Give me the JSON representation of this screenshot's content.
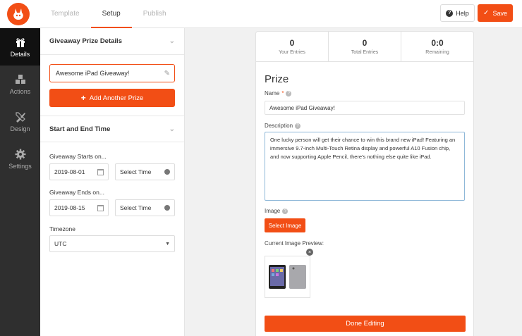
{
  "header": {
    "tabs": [
      {
        "label": "Template"
      },
      {
        "label": "Setup"
      },
      {
        "label": "Publish"
      }
    ],
    "help_label": "Help",
    "save_label": "Save",
    "accent_color": "#f24e15"
  },
  "sidebar": {
    "items": [
      {
        "label": "Details",
        "icon": "gift-icon",
        "active": true
      },
      {
        "label": "Actions",
        "icon": "cubes-icon"
      },
      {
        "label": "Design",
        "icon": "paint-brush-icon"
      },
      {
        "label": "Settings",
        "icon": "gear-icon"
      }
    ]
  },
  "panel": {
    "prize_section_title": "Giveaway Prize Details",
    "prize_name": "Awesome iPad Giveaway!",
    "add_prize_label": "Add Another Prize",
    "dates_section_title": "Start and End Time",
    "starts_label": "Giveaway Starts on...",
    "start_date": "2019-08-01",
    "start_time_placeholder": "Select Time",
    "ends_label": "Giveaway Ends on...",
    "end_date": "2019-08-15",
    "end_time_placeholder": "Select Time",
    "timezone_label": "Timezone",
    "timezone_value": "UTC"
  },
  "preview": {
    "stats": [
      {
        "value": "0",
        "label": "Your Entries"
      },
      {
        "value": "0",
        "label": "Total Entries"
      },
      {
        "value": "0:0",
        "label": "Remaining"
      }
    ],
    "section_title": "Prize",
    "name_label": "Name",
    "name_required": "*",
    "name_value": "Awesome iPad Giveaway!",
    "description_label": "Description",
    "description_value": "One lucky person will get their chance to win this brand new iPad! Featuring an immersive 9.7-inch Multi-Touch Retina display and powerful A10 Fusion chip, and now supporting Apple Pencil, there's nothing else quite like iPad.",
    "image_label": "Image",
    "select_image_label": "Select Image",
    "current_preview_label": "Current Image Preview:",
    "done_label": "Done Editing"
  }
}
